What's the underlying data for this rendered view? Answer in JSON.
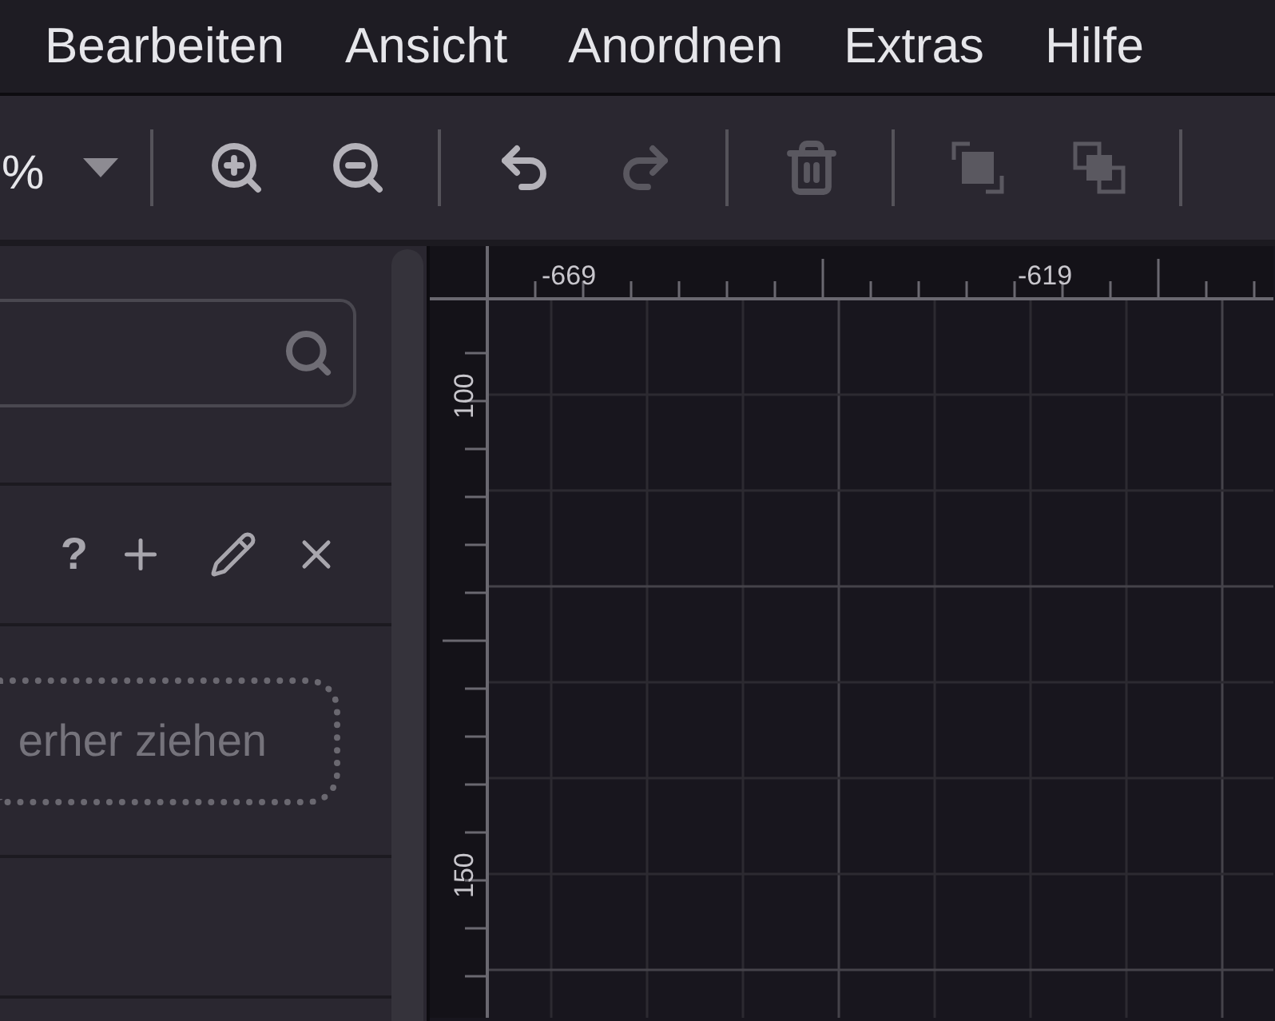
{
  "menu": [
    {
      "label": "Bearbeiten"
    },
    {
      "label": "Ansicht"
    },
    {
      "label": "Anordnen"
    },
    {
      "label": "Extras"
    },
    {
      "label": "Hilfe"
    }
  ],
  "toolbar": {
    "zoom": "%",
    "buttons": [
      {
        "kind": "zoom-in",
        "disabled": false
      },
      {
        "kind": "zoom-out",
        "disabled": false
      },
      {
        "kind": "undo",
        "disabled": false
      },
      {
        "kind": "redo",
        "disabled": true
      },
      {
        "kind": "delete",
        "disabled": true
      },
      {
        "kind": "to-front",
        "disabled": true
      },
      {
        "kind": "to-back",
        "disabled": true
      }
    ]
  },
  "sidebar": {
    "panel_help": "?",
    "drop_hint": "erher ziehen"
  },
  "canvas": {
    "x_labels": [
      "-669",
      "-619"
    ],
    "y_labels": [
      "100",
      "150"
    ]
  }
}
